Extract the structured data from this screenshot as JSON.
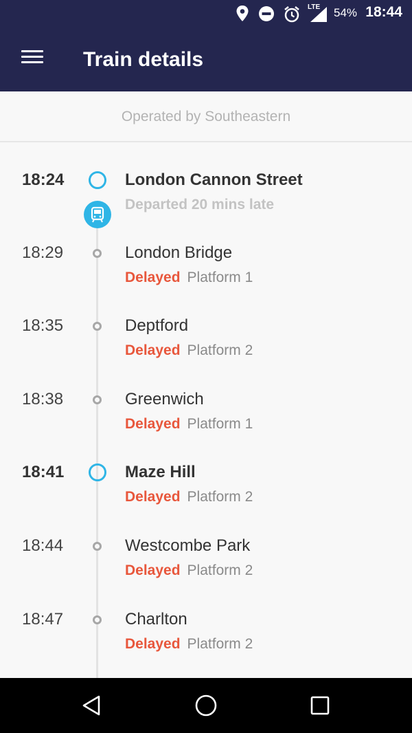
{
  "status_bar": {
    "battery_percent": "54%",
    "time": "18:44",
    "network_label": "LTE",
    "icons": [
      "location-icon",
      "do-not-disturb-icon",
      "alarm-icon",
      "signal-icon"
    ]
  },
  "app_bar": {
    "title": "Train details",
    "menu_icon": "hamburger-menu-icon"
  },
  "operator": "Operated by Southeastern",
  "colors": {
    "primary": "#24264f",
    "accent": "#2fb5e6",
    "delayed": "#e8573c"
  },
  "stops": [
    {
      "time": "18:24",
      "name": "London Cannon Street",
      "status": "Departed 20 mins late",
      "platform": "",
      "major": true
    },
    {
      "time": "18:29",
      "name": "London Bridge",
      "status": "Delayed",
      "platform": "Platform 1",
      "major": false
    },
    {
      "time": "18:35",
      "name": "Deptford",
      "status": "Delayed",
      "platform": "Platform 2",
      "major": false
    },
    {
      "time": "18:38",
      "name": "Greenwich",
      "status": "Delayed",
      "platform": "Platform 1",
      "major": false
    },
    {
      "time": "18:41",
      "name": "Maze Hill",
      "status": "Delayed",
      "platform": "Platform 2",
      "major": true
    },
    {
      "time": "18:44",
      "name": "Westcombe Park",
      "status": "Delayed",
      "platform": "Platform 2",
      "major": false
    },
    {
      "time": "18:47",
      "name": "Charlton",
      "status": "Delayed",
      "platform": "Platform 2",
      "major": false
    }
  ],
  "train_position_icon": "train-icon",
  "nav_bar": [
    "back-icon",
    "home-icon",
    "recents-icon"
  ]
}
